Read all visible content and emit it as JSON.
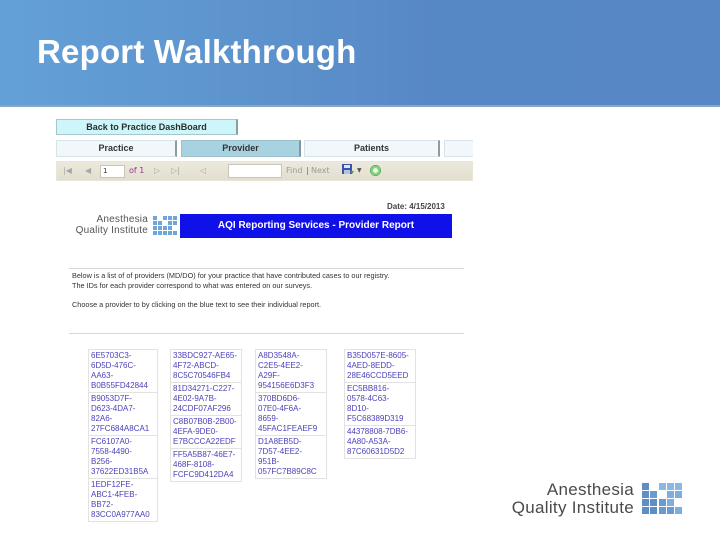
{
  "slide": {
    "title": "Report Walkthrough"
  },
  "report": {
    "back_button": "Back to Practice DashBoard",
    "tabs": [
      {
        "label": "Practice",
        "active": false
      },
      {
        "label": "Provider",
        "active": true
      },
      {
        "label": "Patients",
        "active": false
      },
      {
        "label": "",
        "active": false
      }
    ],
    "toolbar": {
      "first_icon": "first-page-icon",
      "prev_icon": "previous-page-icon",
      "page_value": "1",
      "of_label": "of 1",
      "next_icon": "next-page-icon",
      "last_icon": "last-page-icon",
      "back_icon": "back-to-parent-icon",
      "find_value": "",
      "find_label": "Find",
      "separator": "|",
      "next_label": "Next",
      "export_icon": "save-export-icon",
      "refresh_icon": "refresh-icon"
    },
    "date": "Date: 4/15/2013",
    "logo": {
      "line1": "Anesthesia",
      "line2": "Quality Institute"
    },
    "banner": "AQI Reporting Services - Provider Report",
    "intro": {
      "line1": "Below is a list of of providers (MD/DO) for your practice that have contributed cases to our registry.",
      "line2": "The IDs for each provider correspond to what was entered on our surveys.",
      "line3": "Choose a provider to by clicking on the blue text to see their individual report."
    },
    "providers": {
      "col1": [
        [
          "6E5703C3-",
          "6D5D-476C-",
          "AA63-",
          "B0B55FD42844"
        ],
        [
          "B9053D7F-",
          "D623-4DA7-",
          "82A6-",
          "27FC684A8CA1"
        ],
        [
          "FC6107A0-",
          "7558-4490-",
          "B256-",
          "37622ED31B5A"
        ],
        [
          "1EDF12FE-",
          "ABC1-4FEB-",
          "BB72-",
          "83CC0A977AA0"
        ]
      ],
      "col2": [
        [
          "33BDC927-AE65-",
          "4F72-ABCD-",
          "8C5C70546FB4"
        ],
        [
          "81D34271-C227-",
          "4E02-9A7B-",
          "24CDF07AF296"
        ],
        [
          "C8B07B0B-2B00-",
          "4EFA-9DE0-",
          "E7BCCCA22EDF"
        ],
        [
          "FF5A5B87-46E7-",
          "468F-8108-",
          "FCFC9D412DA4"
        ]
      ],
      "col3": [
        [
          "A8D3548A-",
          "C2E5-4EE2-",
          "A29F-",
          "954156E6D3F3"
        ],
        [
          "370BD6D6-",
          "07E0-4F6A-",
          "8659-",
          "45FAC1FEAEF9"
        ],
        [
          "D1A8EB5D-",
          "7D57-4EE2-",
          "951B-",
          "057FC7B89C8C"
        ]
      ],
      "col4": [
        [
          "B35D057E-8605-",
          "4AED-8EDD-",
          "28E46CCD5EED"
        ],
        [
          "EC5BB816-",
          "0578-4C63-",
          "8D10-",
          "F5C68389D319"
        ],
        [
          "44378808-7DB6-",
          "4A80-A53A-",
          "87C60631D5D2"
        ]
      ]
    }
  },
  "footer_logo": {
    "line1": "Anesthesia",
    "line2": "Quality Institute"
  },
  "colors": {
    "header_blue": "#5787c5",
    "banner_blue": "#1010e8",
    "link_purple_blue": "#4b42b8",
    "tab_active": "#a9d2e0",
    "back_button": "#cdf6fb"
  }
}
